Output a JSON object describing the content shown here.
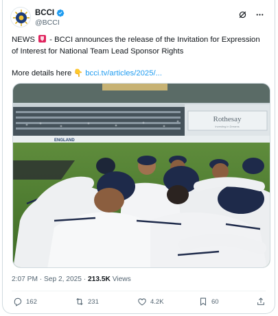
{
  "tweet": {
    "author_name": "BCCI",
    "author_handle": "@BCCI",
    "text_line1_prefix": "NEWS",
    "text_line1_rest": " - BCCI announces the release of the Invitation for Expression of Interest for National Team Lead Sponsor Rights",
    "details_prefix": "More details here ",
    "details_link": "bcci.tv/articles/2025/...",
    "timestamp": "2:07 PM · Sep 2, 2025 · ",
    "views_count": "213.5K",
    "views_label": " Views"
  },
  "photo": {
    "stadium_banner_left": "Rothesay",
    "stadium_banner_right": "Rothesay",
    "stadium_banner_small": "Investing in Dreams",
    "boundary_board_left": "ENGLAND",
    "boundary_board_right": "hesay"
  },
  "actions": {
    "replies": "162",
    "reposts": "231",
    "likes": "4.2K",
    "bookmarks": "60"
  },
  "colors": {
    "accent": "#1d9bf0",
    "text": "#0f1419",
    "muted": "#536471"
  },
  "icons": {
    "verified": "verified-badge-icon",
    "grok": "grok-icon",
    "more": "more-options-icon",
    "reply": "reply-icon",
    "repost": "repost-icon",
    "like": "heart-icon",
    "bookmark": "bookmark-icon",
    "share": "share-icon",
    "flag": "red-flag-emoji-icon",
    "pointing": "pointing-down-emoji-icon"
  }
}
